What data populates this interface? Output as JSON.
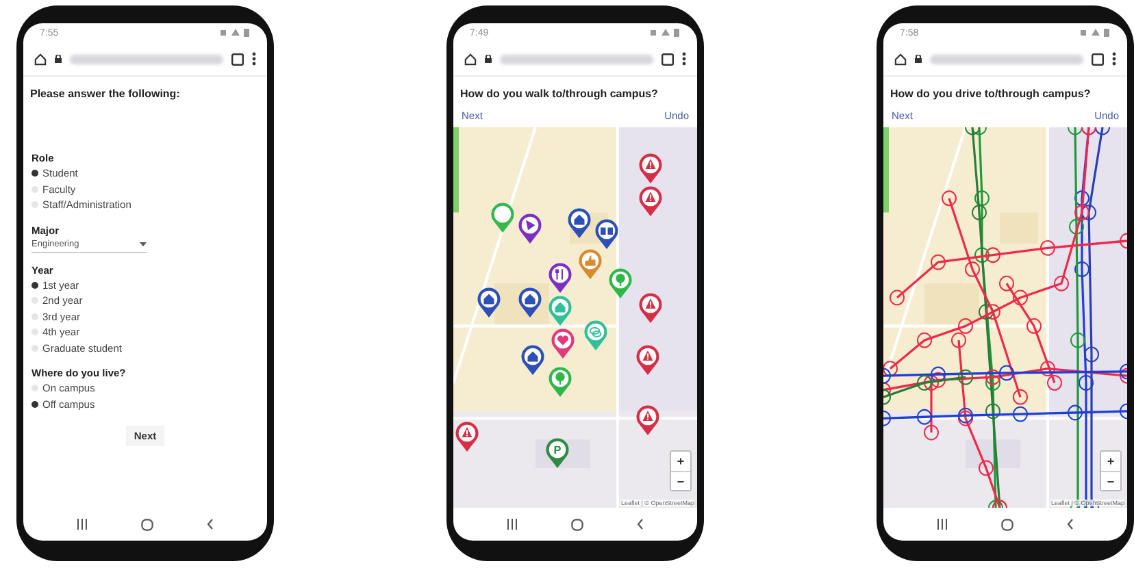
{
  "phones": [
    {
      "kind": "form",
      "time": "7:55",
      "title": "Please answer the following:",
      "groups": [
        {
          "label": "Role",
          "kind": "radio",
          "options": [
            {
              "label": "Student",
              "selected": true
            },
            {
              "label": "Faculty",
              "selected": false
            },
            {
              "label": "Staff/Administration",
              "selected": false
            }
          ]
        },
        {
          "label": "Major",
          "kind": "select",
          "value": "Engineering"
        },
        {
          "label": "Year",
          "kind": "radio",
          "options": [
            {
              "label": "1st year",
              "selected": true
            },
            {
              "label": "2nd year",
              "selected": false
            },
            {
              "label": "3rd year",
              "selected": false
            },
            {
              "label": "4th year",
              "selected": false
            },
            {
              "label": "Graduate student",
              "selected": false
            }
          ]
        },
        {
          "label": "Where do you live?",
          "kind": "radio",
          "options": [
            {
              "label": "On campus",
              "selected": false
            },
            {
              "label": "Off campus",
              "selected": true
            }
          ]
        }
      ],
      "button": "Next"
    },
    {
      "kind": "walk-map",
      "time": "7:49",
      "title": "How do you walk to/through campus?",
      "next": "Next",
      "undo": "Undo",
      "zoom_in": "+",
      "zoom_out": "−",
      "attribution": "Leaflet | © OpenStreetMap",
      "markers": [
        {
          "kind": "warning",
          "color": "#d62f45"
        },
        {
          "kind": "warning",
          "color": "#d62f45"
        },
        {
          "kind": "ring",
          "color": "#33b84e"
        },
        {
          "kind": "play",
          "color": "#7b2fc4"
        },
        {
          "kind": "house",
          "color": "#2c4fb8"
        },
        {
          "kind": "book",
          "color": "#2c4fb8"
        },
        {
          "kind": "thumb",
          "color": "#d98a2a"
        },
        {
          "kind": "cutlery",
          "color": "#7b2fc4"
        },
        {
          "kind": "tree",
          "color": "#2fb84a"
        },
        {
          "kind": "warning",
          "color": "#d62f45"
        },
        {
          "kind": "house",
          "color": "#2c4fb8"
        },
        {
          "kind": "house",
          "color": "#2c4fb8"
        },
        {
          "kind": "house",
          "color": "#2fbf9a"
        },
        {
          "kind": "heart",
          "color": "#e03a7a"
        },
        {
          "kind": "chat",
          "color": "#2fbf9a"
        },
        {
          "kind": "warning",
          "color": "#d62f45"
        },
        {
          "kind": "house",
          "color": "#2c4fb8"
        },
        {
          "kind": "tree",
          "color": "#2fb84a"
        },
        {
          "kind": "warning",
          "color": "#d62f45"
        },
        {
          "kind": "warning",
          "color": "#d62f45"
        },
        {
          "kind": "parking",
          "color": "#2f8a44",
          "label": "P"
        }
      ]
    },
    {
      "kind": "drive-map",
      "time": "7:58",
      "title": "How do you drive to/through campus?",
      "next": "Next",
      "undo": "Undo",
      "zoom_in": "+",
      "zoom_out": "−",
      "attribution": "Leaflet | © OpenStreetMap"
    }
  ]
}
